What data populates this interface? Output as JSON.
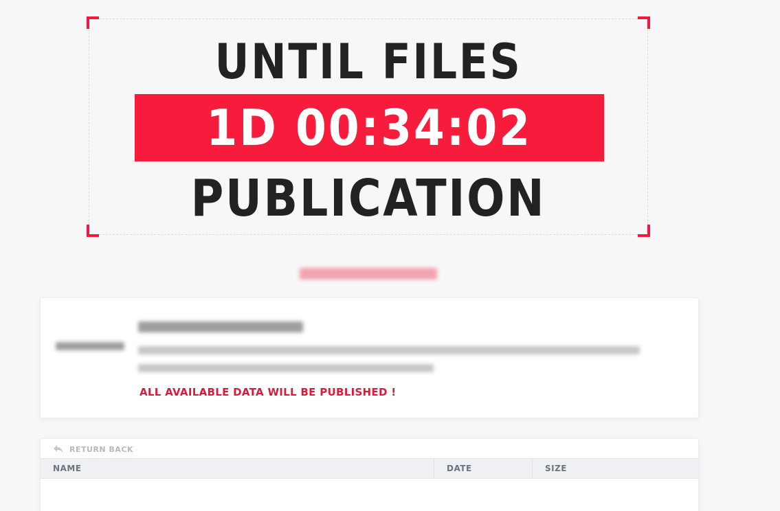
{
  "countdown": {
    "line_top": "UNTIL FILES",
    "timer": "1D 00:34:02",
    "line_bottom": "PUBLICATION"
  },
  "colors": {
    "accent": "#f81c3c",
    "warning": "#e0193a",
    "headline": "#222222",
    "background": "#f7f7f8"
  },
  "info": {
    "warning": "ALL AVAILABLE DATA WILL BE PUBLISHED !"
  },
  "files": {
    "return_label": "RETURN BACK",
    "return_icon": "reply-arrow-icon",
    "columns": [
      "NAME",
      "DATE",
      "SIZE"
    ]
  }
}
